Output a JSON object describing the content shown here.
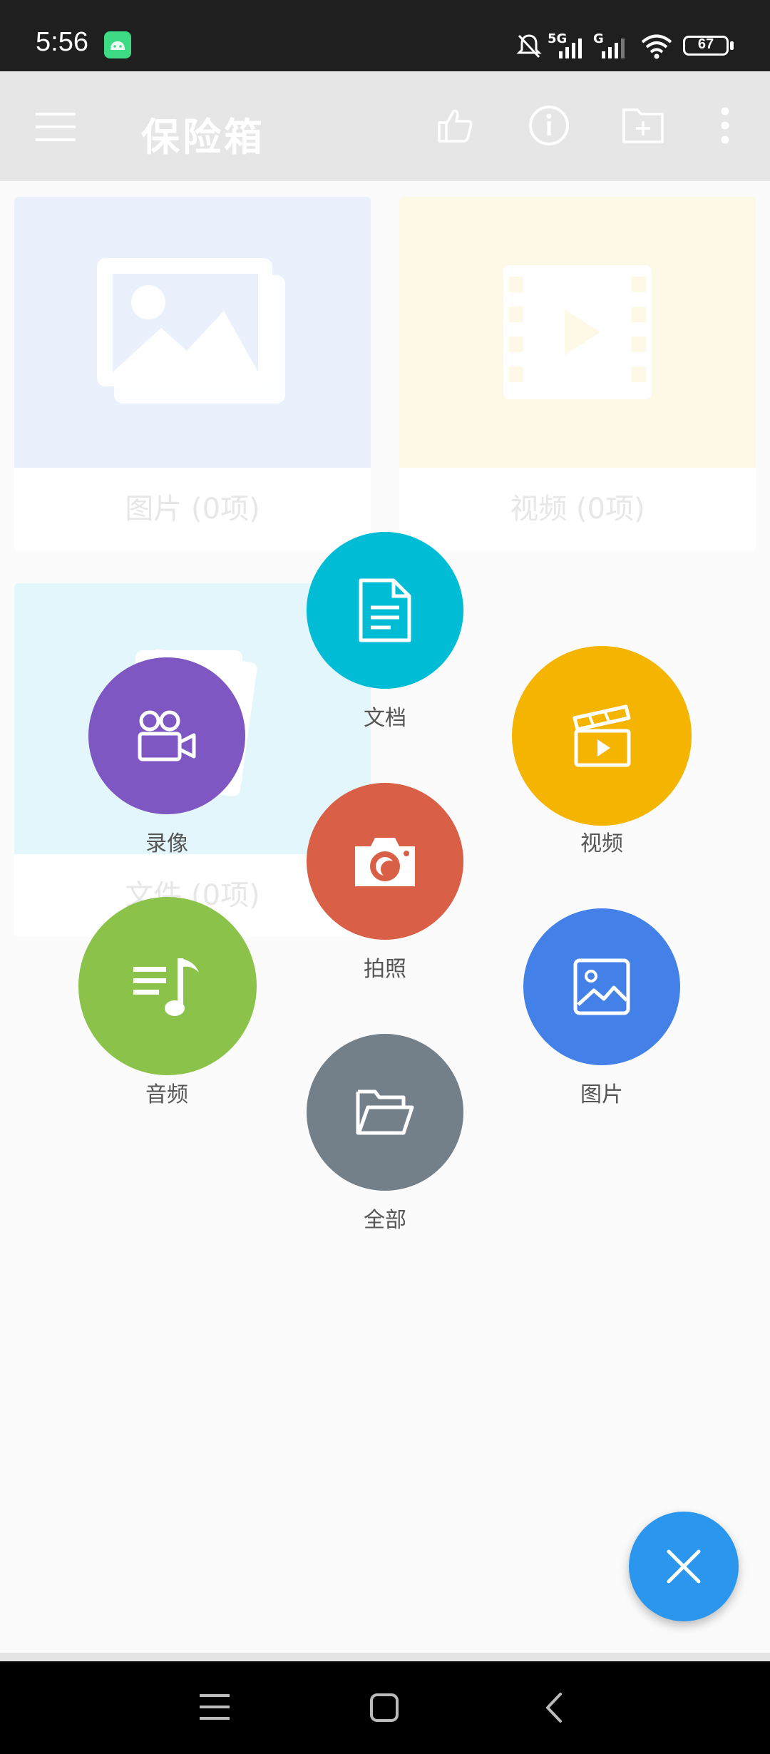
{
  "status_bar": {
    "time": "5:56",
    "battery": "67",
    "network_1": "5G",
    "network_2": "G"
  },
  "app_bar": {
    "title": "保险箱"
  },
  "cards": [
    {
      "label": "图片 (0项)",
      "bg": "#eaf1fd",
      "icon": "photo-icon"
    },
    {
      "label": "视频 (0项)",
      "bg": "#fdf9e6",
      "icon": "film-icon"
    },
    {
      "label": "文件 (0项)",
      "bg": "#e3f6fb",
      "icon": "file-icon"
    }
  ],
  "menu": {
    "document": {
      "label": "文档",
      "color": "#00bcd4",
      "icon": "document-icon"
    },
    "record": {
      "label": "录像",
      "color": "#7e57c2",
      "icon": "video-camera-icon"
    },
    "video": {
      "label": "视频",
      "color": "#f4b400",
      "icon": "clapperboard-icon"
    },
    "photo_take": {
      "label": "拍照",
      "color": "#d95f46",
      "icon": "camera-icon"
    },
    "audio": {
      "label": "音频",
      "color": "#8bc34a",
      "icon": "music-icon"
    },
    "image": {
      "label": "图片",
      "color": "#4381e8",
      "icon": "image-icon"
    },
    "all": {
      "label": "全部",
      "color": "#737f89",
      "icon": "folder-icon"
    }
  },
  "fab": {
    "icon": "close-icon",
    "color": "#2a96ee"
  }
}
